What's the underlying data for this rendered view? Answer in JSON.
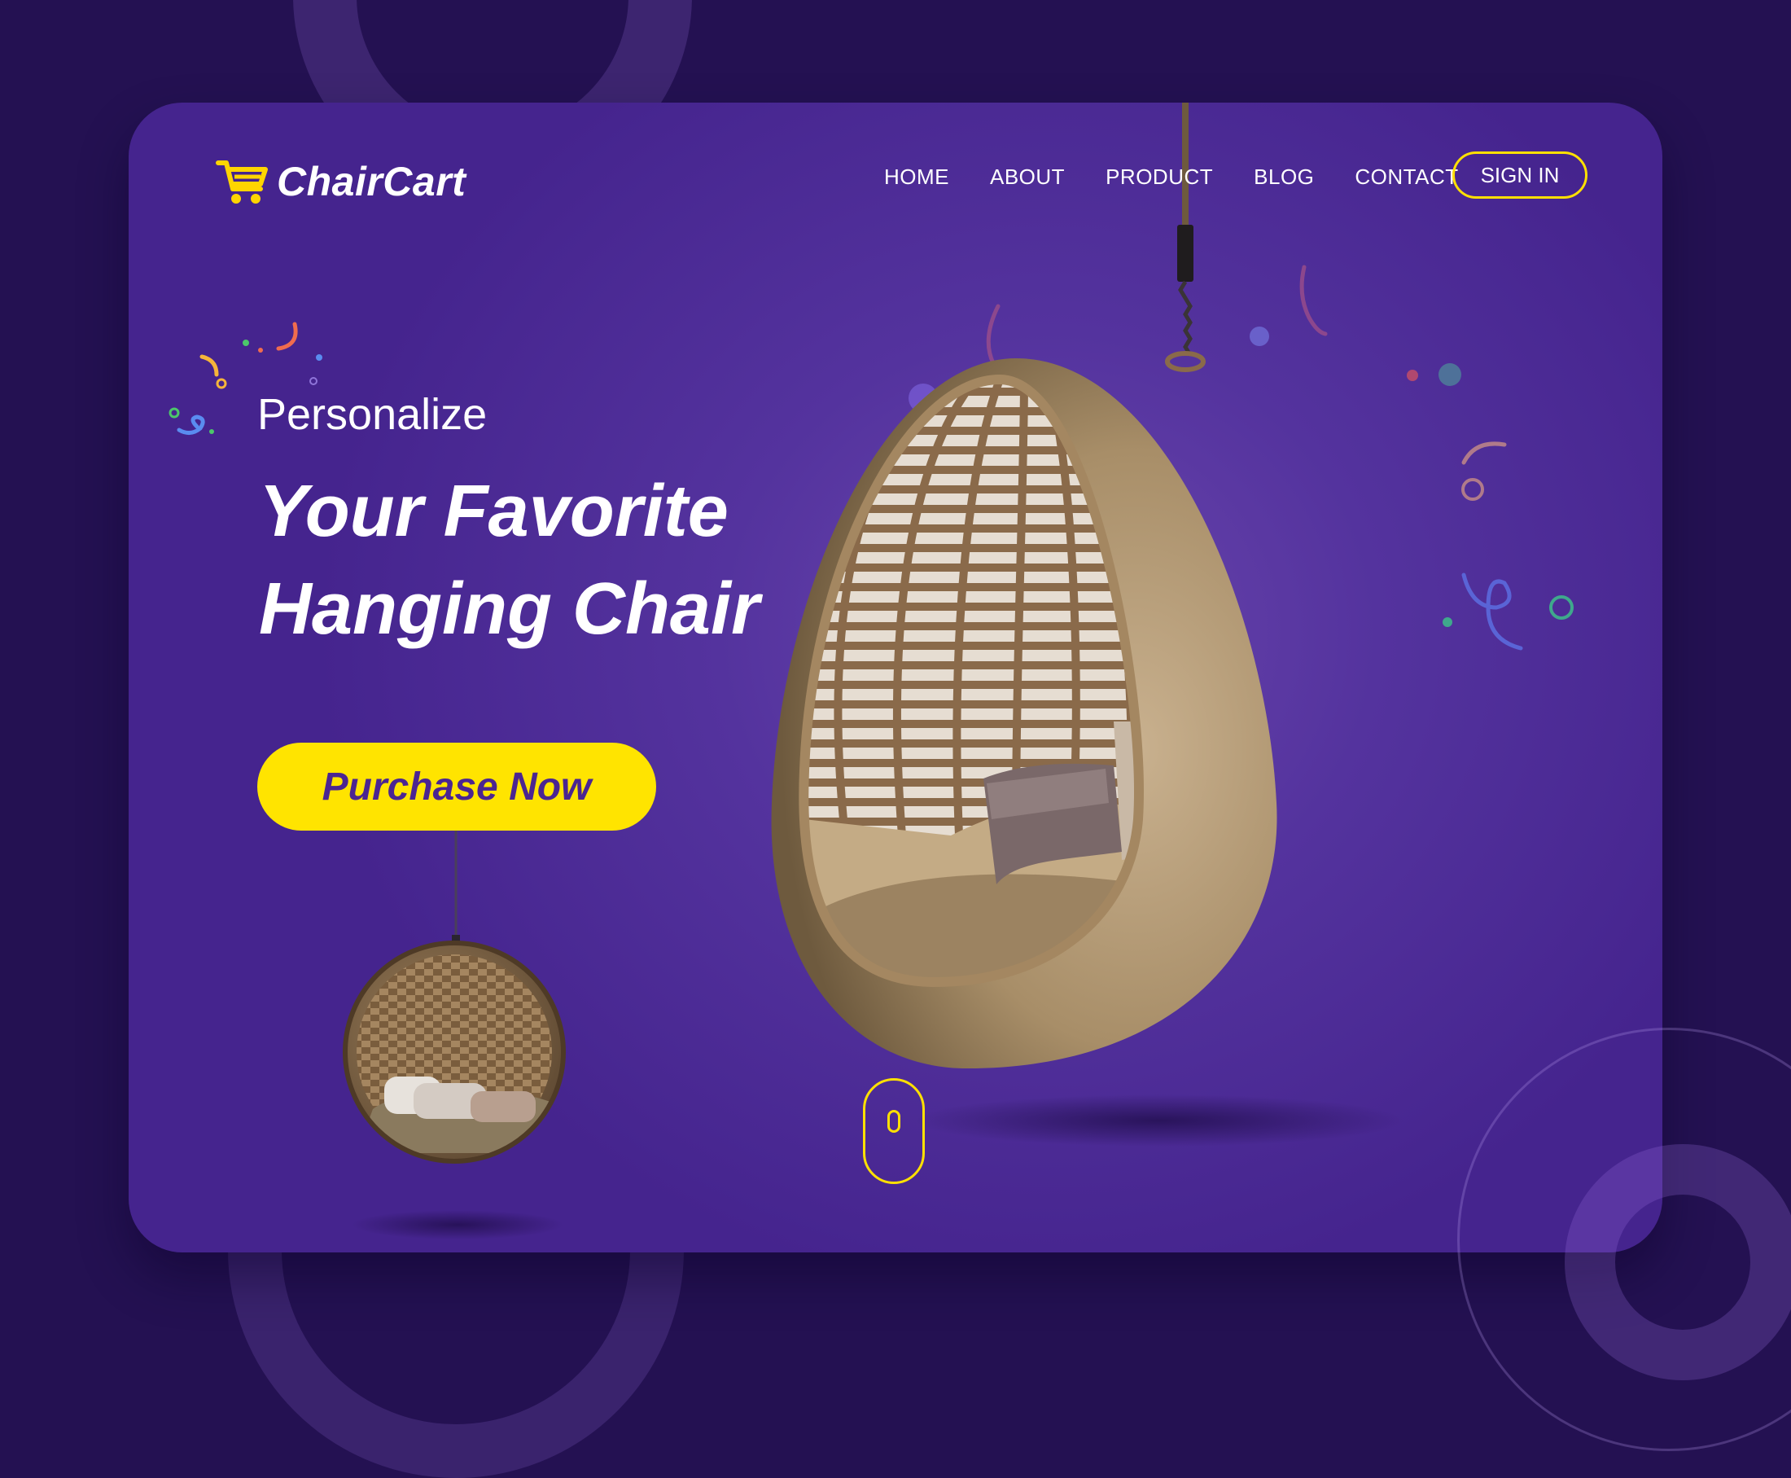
{
  "brand": {
    "name": "ChairCart",
    "icon": "shopping-cart-icon",
    "icon_color": "#ffd500"
  },
  "nav": {
    "items": [
      {
        "label": "HOME"
      },
      {
        "label": "ABOUT"
      },
      {
        "label": "PRODUCT"
      },
      {
        "label": "BLOG"
      },
      {
        "label": "CONTACT"
      }
    ],
    "signin_label": "SIGN IN"
  },
  "hero": {
    "kicker": "Personalize",
    "headline_line1": "Your Favorite",
    "headline_line2": "Hanging Chair",
    "cta_label": "Purchase Now"
  },
  "colors": {
    "background": "#241152",
    "card": "#54339e",
    "accent": "#ffe400",
    "cta_text": "#4b2591"
  },
  "icons": [
    "shopping-cart-icon",
    "scroll-mouse-icon",
    "confetti"
  ]
}
